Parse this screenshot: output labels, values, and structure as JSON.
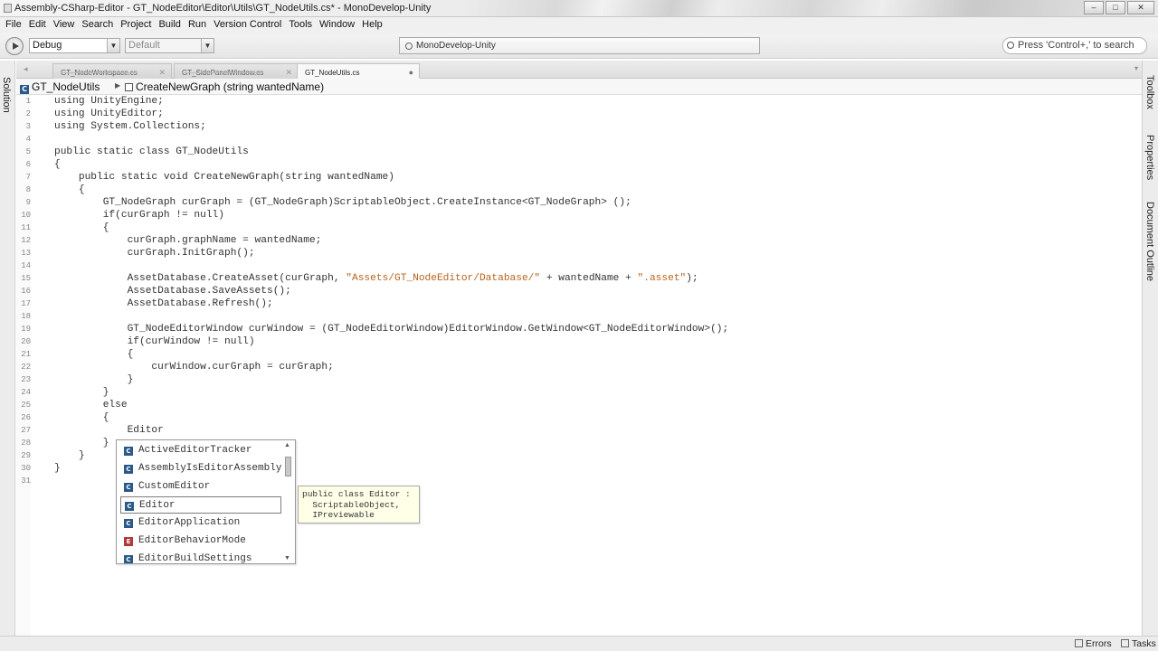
{
  "window": {
    "title": "Assembly-CSharp-Editor - GT_NodeEditor\\Editor\\Utils\\GT_NodeUtils.cs* - MonoDevelop-Unity",
    "minimize": "–",
    "maximize": "□",
    "close": "✕"
  },
  "menu": [
    "File",
    "Edit",
    "View",
    "Search",
    "Project",
    "Build",
    "Run",
    "Version Control",
    "Tools",
    "Window",
    "Help"
  ],
  "toolbar": {
    "config": "Debug",
    "platform": "Default",
    "status": "MonoDevelop-Unity",
    "search_placeholder": "Press 'Control+,' to search"
  },
  "left_pads": [
    "Solution"
  ],
  "right_pads": [
    "Toolbox",
    "Properties",
    "Document Outline"
  ],
  "tabs": [
    {
      "label": "GT_NodeWorkspace.cs",
      "active": false
    },
    {
      "label": "GT_SidePanelWindow.cs",
      "active": false
    },
    {
      "label": "GT_NodeUtils.cs",
      "active": true
    }
  ],
  "breadcrumb": {
    "class": "GT_NodeUtils",
    "method": "CreateNewGraph (string wantedName)"
  },
  "code_lines": [
    {
      "n": "1",
      "text": "using UnityEngine;"
    },
    {
      "n": "2",
      "text": "using UnityEditor;"
    },
    {
      "n": "3",
      "text": "using System.Collections;"
    },
    {
      "n": "4",
      "text": ""
    },
    {
      "n": "5",
      "text": "public static class GT_NodeUtils"
    },
    {
      "n": "6",
      "text": "{"
    },
    {
      "n": "7",
      "text": "    public static void CreateNewGraph(string wantedName)"
    },
    {
      "n": "8",
      "text": "    {"
    },
    {
      "n": "9",
      "text": "        GT_NodeGraph curGraph = (GT_NodeGraph)ScriptableObject.CreateInstance<GT_NodeGraph> ();"
    },
    {
      "n": "10",
      "text": "        if(curGraph != null)"
    },
    {
      "n": "11",
      "text": "        {"
    },
    {
      "n": "12",
      "text": "            curGraph.graphName = wantedName;"
    },
    {
      "n": "13",
      "text": "            curGraph.InitGraph();"
    },
    {
      "n": "14",
      "text": ""
    },
    {
      "n": "15",
      "text": "            AssetDatabase.CreateAsset(curGraph, \"Assets/GT_NodeEditor/Database/\" + wantedName + \".asset\");"
    },
    {
      "n": "16",
      "text": "            AssetDatabase.SaveAssets();"
    },
    {
      "n": "17",
      "text": "            AssetDatabase.Refresh();"
    },
    {
      "n": "18",
      "text": ""
    },
    {
      "n": "19",
      "text": "            GT_NodeEditorWindow curWindow = (GT_NodeEditorWindow)EditorWindow.GetWindow<GT_NodeEditorWindow>();"
    },
    {
      "n": "20",
      "text": "            if(curWindow != null)"
    },
    {
      "n": "21",
      "text": "            {"
    },
    {
      "n": "22",
      "text": "                curWindow.curGraph = curGraph;"
    },
    {
      "n": "23",
      "text": "            }"
    },
    {
      "n": "24",
      "text": "        }"
    },
    {
      "n": "25",
      "text": "        else"
    },
    {
      "n": "26",
      "text": "        {"
    },
    {
      "n": "27",
      "text": "            Editor"
    },
    {
      "n": "28",
      "text": "        }"
    },
    {
      "n": "29",
      "text": "    }"
    },
    {
      "n": "30",
      "text": "}"
    },
    {
      "n": "31",
      "text": ""
    }
  ],
  "completion": {
    "items": [
      {
        "label": "ActiveEditorTracker",
        "kind": "C"
      },
      {
        "label": "AssemblyIsEditorAssembly",
        "kind": "C"
      },
      {
        "label": "CustomEditor",
        "kind": "C"
      },
      {
        "label": "Editor",
        "kind": "C",
        "selected": true
      },
      {
        "label": "EditorApplication",
        "kind": "C"
      },
      {
        "label": "EditorBehaviorMode",
        "kind": "E"
      },
      {
        "label": "EditorBuildSettings",
        "kind": "C"
      }
    ],
    "tooltip": "public class Editor :\n  ScriptableObject,\n  IPreviewable"
  },
  "status_pads": [
    "Errors",
    "Tasks"
  ],
  "colors": {
    "string": "#b5641b",
    "class_icon": "#2a5a8a",
    "enum_icon": "#b13a3a"
  }
}
